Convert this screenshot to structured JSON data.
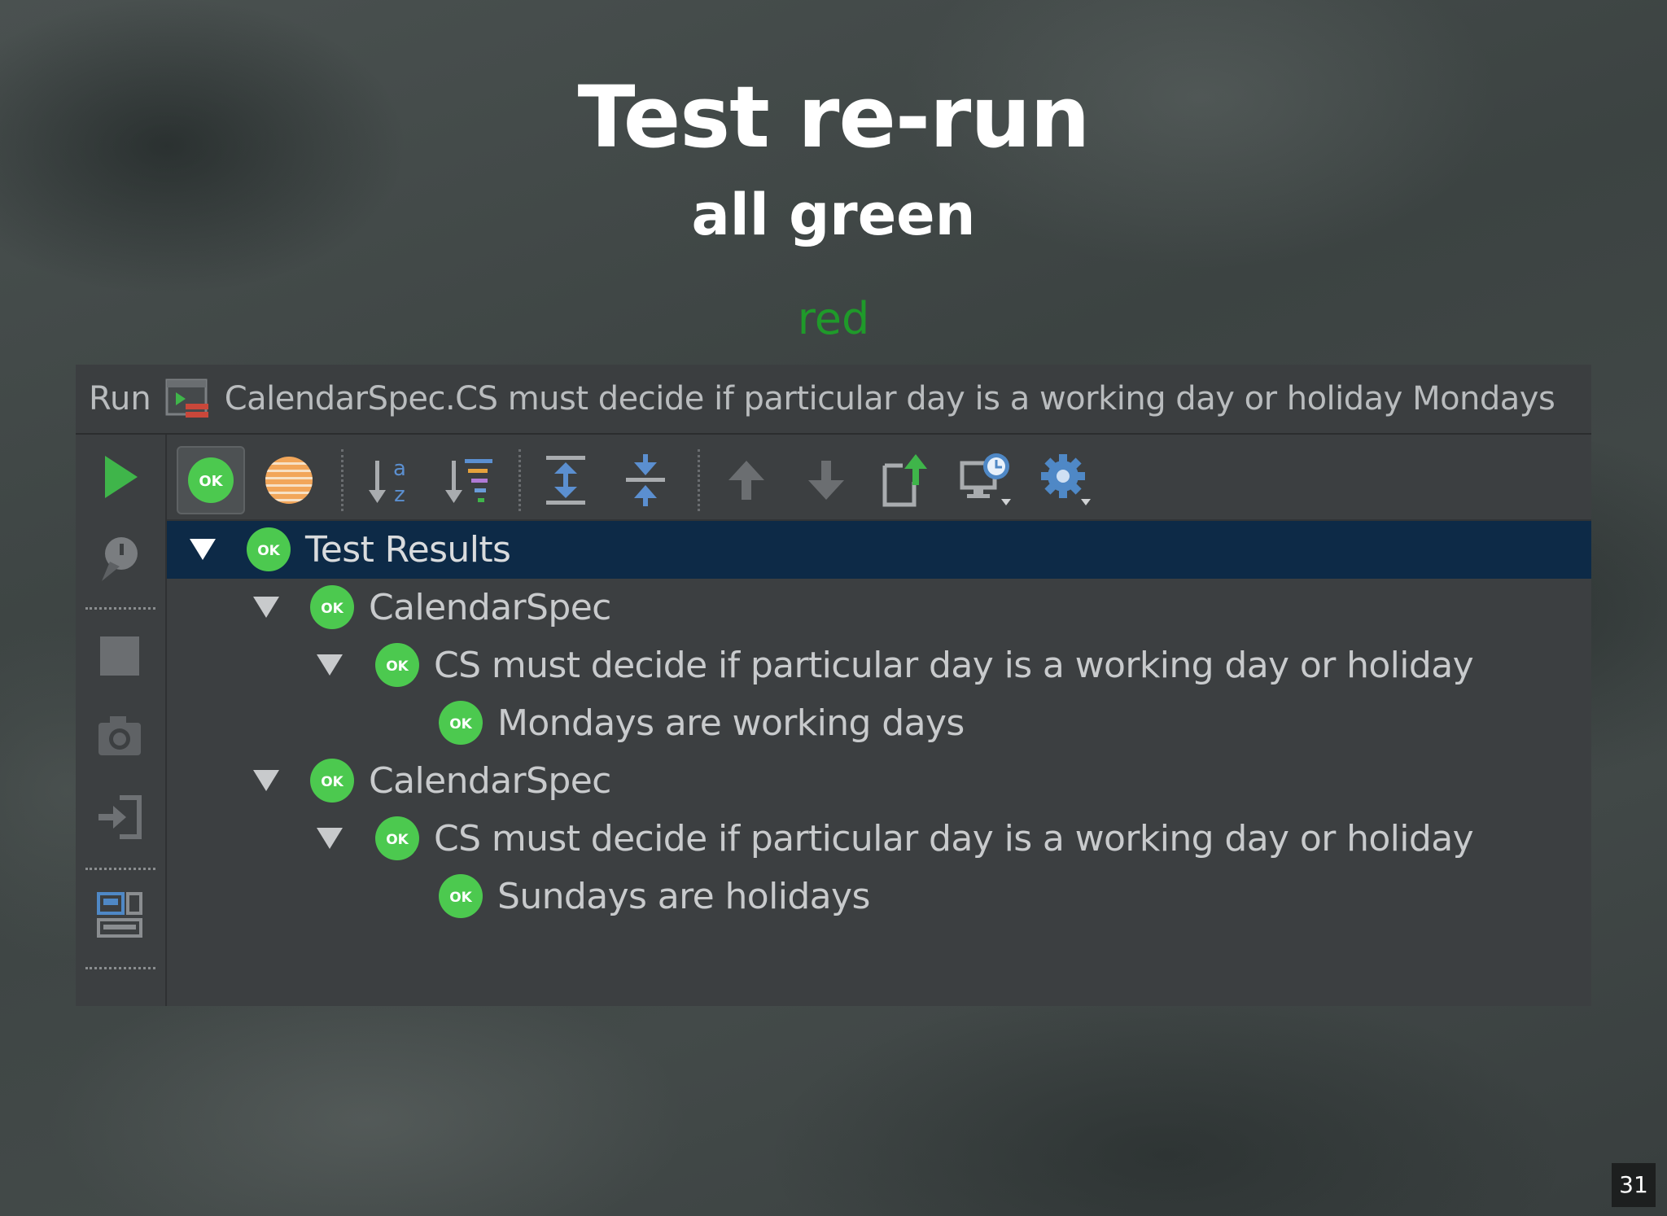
{
  "slide": {
    "title": "Test re-run",
    "subtitle": "all green",
    "ghost_word": "red",
    "page_number": "31"
  },
  "ide": {
    "titlebar": {
      "run_label": "Run",
      "config_icon": "run-config-icon",
      "config_text": "CalendarSpec.CS must decide if particular day is a working day or holiday Mondays"
    },
    "left_strip": [
      {
        "name": "rerun-icon",
        "icon": "green-play-triangle"
      },
      {
        "name": "rerun-failed-icon",
        "icon": "pin-bubble"
      },
      {
        "name": "stop-icon",
        "icon": "square"
      },
      {
        "name": "dump-threads-icon",
        "icon": "camera"
      },
      {
        "name": "exit-icon",
        "icon": "arrow-into-door"
      },
      {
        "name": "layout-icon",
        "icon": "layout-panels"
      }
    ],
    "toolbar": [
      {
        "name": "show-passed-icon",
        "icon": "ok-badge",
        "pressed": true
      },
      {
        "name": "show-ignored-icon",
        "icon": "orange-striped-circle",
        "pressed": false
      },
      {
        "name": "sort-alphabetically-icon",
        "icon": "sort-az",
        "pressed": false
      },
      {
        "name": "sort-by-duration-icon",
        "icon": "sort-duration",
        "pressed": false
      },
      {
        "name": "expand-all-icon",
        "icon": "expand-all",
        "pressed": false
      },
      {
        "name": "collapse-all-icon",
        "icon": "collapse-all",
        "pressed": false
      },
      {
        "name": "previous-occurrence-icon",
        "icon": "arrow-up",
        "pressed": false
      },
      {
        "name": "next-occurrence-icon",
        "icon": "arrow-down",
        "pressed": false
      },
      {
        "name": "export-results-icon",
        "icon": "export",
        "pressed": false
      },
      {
        "name": "test-history-icon",
        "icon": "monitor-clock",
        "pressed": false
      },
      {
        "name": "settings-icon",
        "icon": "gear",
        "pressed": false
      }
    ],
    "tree": [
      {
        "label": "Test Results",
        "status": "OK",
        "level": 0,
        "expanded": true,
        "selected": true
      },
      {
        "label": "CalendarSpec",
        "status": "OK",
        "level": 1,
        "expanded": true,
        "selected": false
      },
      {
        "label": "CS must decide if particular day is a working day or holiday",
        "status": "OK",
        "level": 2,
        "expanded": true,
        "selected": false
      },
      {
        "label": "Mondays are working days",
        "status": "OK",
        "level": 3,
        "expanded": false,
        "selected": false
      },
      {
        "label": "CalendarSpec",
        "status": "OK",
        "level": 1,
        "expanded": true,
        "selected": false
      },
      {
        "label": "CS must decide if particular day is a working day or holiday",
        "status": "OK",
        "level": 2,
        "expanded": true,
        "selected": false
      },
      {
        "label": "Sundays are holidays",
        "status": "OK",
        "level": 3,
        "expanded": false,
        "selected": false
      }
    ]
  },
  "colors": {
    "ok_green": "#4cc94f",
    "play_green": "#3fb54a",
    "selection": "#0d2a47",
    "panel": "#3c3f41",
    "text": "#c8cacc"
  }
}
